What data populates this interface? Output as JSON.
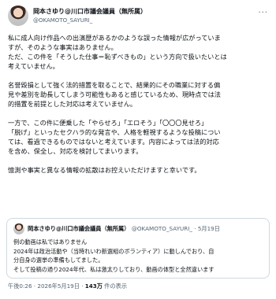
{
  "post": {
    "author_name": "岡本さゆり@川口市議会議員（無所属）",
    "author_handle": "@OKAMOTO_SAYURI_",
    "menu_icon": "ellipsis-icon",
    "paragraphs": [
      [
        "私に成人向け作品への出演歴があるかのような誤った情報が広がっていま",
        "すが、そのような事実はありません。",
        "ただ、この件を「そうした仕事＝恥ずべきもの」という方向で扱いたいとは",
        "考えていません。"
      ],
      [
        "名誉毀損として強く法的措置を取ることで、結果的にその職業に対する偏",
        "見や差別を助長してしまう可能性もあると感じているため、現時点では法",
        "的措置を前提とした対応は考えていません。"
      ],
      [
        "一方で、この件に便乗した「やらせろ」「エロそう」「〇〇〇見せろ」",
        "「脱げ」といったセクハラ的な発言や、人格を軽視するような投稿につい",
        "ては、看過できるものではないと考えています。内容によっては法的対応",
        "を含め、保全し、対応を検討してまいります。"
      ],
      [
        "憶測や事実と異なる情報の拡散はお控えいただけますと幸いです。"
      ]
    ]
  },
  "quoted": {
    "author_name": "岡本さゆり@川口市議会議員（無所属）",
    "author_handle": "@OKAMOTO_SAYURI_",
    "date": "5月19日",
    "lines": [
      "例の動画は私ではありません",
      "2024年は政治活動や（当時れいわ新選組のボランティア）に動しんでおり、自",
      "分自身の選挙の準備もしてました。",
      "そして投稿の通り2024年代、私は激太りしており、動画の体型と全然違います"
    ]
  },
  "meta": {
    "time_date": "午後0:26 · 2026年5月19日 · ",
    "views_count": "143万",
    "views_label": " 件の表示"
  }
}
